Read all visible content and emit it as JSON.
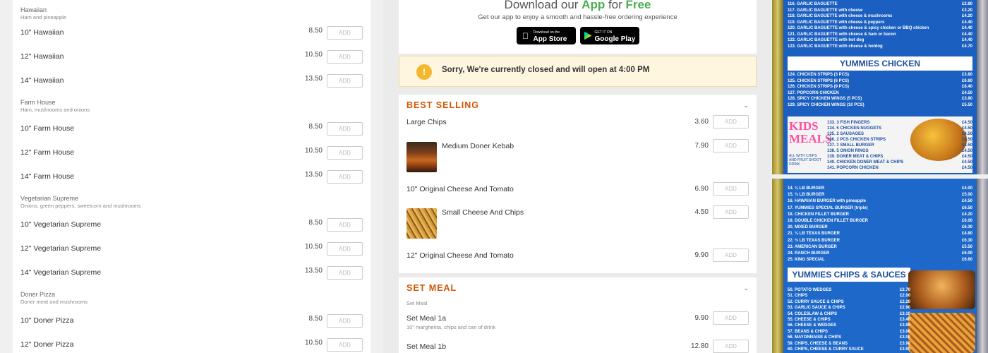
{
  "menu": {
    "add_label": "ADD",
    "groups": [
      {
        "title": "Hawaiian",
        "desc": "Ham and pineapple",
        "items": [
          {
            "name": "10\" Hawaiian",
            "price": "8.50"
          },
          {
            "name": "12\" Hawaiian",
            "price": "10.50"
          },
          {
            "name": "14\" Hawaiian",
            "price": "13.50"
          }
        ]
      },
      {
        "title": "Farm House",
        "desc": "Ham, mushrooms and onions",
        "items": [
          {
            "name": "10\" Farm House",
            "price": "8.50"
          },
          {
            "name": "12\" Farm House",
            "price": "10.50"
          },
          {
            "name": "14\" Farm House",
            "price": "13.50"
          }
        ]
      },
      {
        "title": "Vegetarian Supreme",
        "desc": "Onions, green peppers, sweetcorn and mushrooms",
        "items": [
          {
            "name": "10\" Vegetarian Supreme",
            "price": "8.50"
          },
          {
            "name": "12\" Vegetarian Supreme",
            "price": "10.50"
          },
          {
            "name": "14\" Vegetarian Supreme",
            "price": "13.50"
          }
        ]
      },
      {
        "title": "Doner Pizza",
        "desc": "Doner meat and mushrooms",
        "items": [
          {
            "name": "10\" Doner Pizza",
            "price": "8.50"
          },
          {
            "name": "12\" Doner Pizza",
            "price": "10.50"
          }
        ]
      }
    ]
  },
  "app_promo": {
    "title_prefix": "Download our ",
    "title_app": "App",
    "title_mid": " for ",
    "title_free": "Free",
    "subtitle": "Get our app to enjoy a smooth and hassle-free ordering experience",
    "appstore_small": "Download on the",
    "appstore_big": "App Store",
    "googleplay_small": "GET IT ON",
    "googleplay_big": "Google Play"
  },
  "notice": {
    "icon": "!",
    "text": "Sorry, We're currently closed and will open at 4:00 PM"
  },
  "best_selling": {
    "title": "BEST SELLING",
    "items": [
      {
        "name": "Large Chips",
        "price": "3.60"
      },
      {
        "name": "Medium Doner Kebab",
        "price": "7.90"
      },
      {
        "name": "10\" Original Cheese And Tomato",
        "price": "6.90"
      },
      {
        "name": "Small Cheese And Chips",
        "price": "4.50"
      },
      {
        "name": "12\" Original Cheese And Tomato",
        "price": "9.90"
      }
    ]
  },
  "set_meal": {
    "title": "SET MEAL",
    "label": "Set Meal",
    "items": [
      {
        "name": "Set Meal 1a",
        "desc": "10\" margherita, chips and can of drink",
        "price": "9.90"
      },
      {
        "name": "Set Meal 1b",
        "price": "12.80"
      }
    ]
  },
  "photo_top": {
    "lines": [
      {
        "t": "116. GARLIC BAGUETTE",
        "p": "£2.80"
      },
      {
        "t": "117. GARLIC BAGUETTE with cheese",
        "p": "£3.20"
      },
      {
        "t": "118. GARLIC BAGUETTE with cheese & mushrooms",
        "p": "£4.20"
      },
      {
        "t": "119. GARLIC BAGUETTE with cheese & peppers",
        "p": "£4.40"
      },
      {
        "t": "120. GARLIC BAGUETTE with cheese & spicy chicken or BBQ chicken",
        "p": "£4.40"
      },
      {
        "t": "121. GARLIC BAGUETTE with cheese & ham or bacon",
        "p": "£4.40"
      },
      {
        "t": "122. GARLIC BAGUETTE with hot dog",
        "p": "£4.40"
      },
      {
        "t": "123. GARLIC BAGUETTE with cheese & hotdog",
        "p": "£4.70"
      }
    ],
    "banner": "YUMMIES CHICKEN",
    "chicken": [
      {
        "t": "124. CHICKEN STRIPS (3 PCS)",
        "p": "£3.80"
      },
      {
        "t": "125. CHICKEN STRIPS (6 PCS)",
        "p": "£6.60"
      },
      {
        "t": "126. CHICKEN STRIPS (9 PCS)",
        "p": "£8.40"
      },
      {
        "t": "127. POPCORN CHICKEN",
        "p": "£4.50"
      },
      {
        "t": "128. SPICY CHICKEN WINGS (5 PCS)",
        "p": "£3.80"
      },
      {
        "t": "129. SPICY CHICKEN WINGS (10 PCS)",
        "p": "£5.50"
      }
    ],
    "kids_title": "KIDS MEALS",
    "kids_sub": "ALL WITH CHIPS AND FRUIT SHOOT DRINK",
    "kids": [
      {
        "t": "133. 3 FISH FINGERS",
        "p": "£4.50"
      },
      {
        "t": "134. 5 CHICKEN NUGGETS",
        "p": "£4.50"
      },
      {
        "t": "135. 2 SAUSAGES",
        "p": "£4.50"
      },
      {
        "t": "136. 2 PCS CHICKEN STRIPS",
        "p": "£4.50"
      },
      {
        "t": "137. 1 SMALL BURGER",
        "p": "£4.50"
      },
      {
        "t": "138. 5 ONION RINGS",
        "p": "£4.50"
      },
      {
        "t": "139. DONER MEAT & CHIPS",
        "p": "£4.50"
      },
      {
        "t": "140. CHICKEN DONER MEAT & CHIPS",
        "p": "£4.50"
      },
      {
        "t": "141. POPCORN CHICKEN",
        "p": "£4.50"
      }
    ]
  },
  "photo_bot": {
    "burgers": [
      {
        "t": "14. ¼ LB BURGER",
        "p": "£4.00"
      },
      {
        "t": "15. ½ LB BURGER",
        "p": "£5.00"
      },
      {
        "t": "16. HAWAIIAN BURGER with pineapple",
        "p": "£4.50"
      },
      {
        "t": "17. YUMMIES SPECIAL BURGER (triple)",
        "p": "£6.50"
      },
      {
        "t": "18. CHICKEN FILLET BURGER",
        "p": "£4.20"
      },
      {
        "t": "19. DOUBLE CHICKEN FILLET BURGER",
        "p": "£6.00"
      },
      {
        "t": "20. MIXED BURGER",
        "p": "£6.30"
      },
      {
        "t": "21. ¼ LB TEXAS BURGER",
        "p": "£4.80"
      },
      {
        "t": "22. ½ LB TEXAS BURGER",
        "p": "£6.30"
      },
      {
        "t": "23. AMERICAN BURGER",
        "p": "£5.50"
      },
      {
        "t": "24. RANCH BURGER",
        "p": "£6.00"
      },
      {
        "t": "25. KING SPECIAL",
        "p": "£6.60"
      }
    ],
    "banner": "YUMMIES CHIPS & SAUCES",
    "chips": [
      {
        "t": "50. POTATO WEDGES",
        "p": "£2.70"
      },
      {
        "t": "51. CHIPS",
        "p": "£2.00"
      },
      {
        "t": "52. CURRY SAUCE & CHIPS",
        "p": "£2.20"
      },
      {
        "t": "53. GARLIC SAUCE & CHIPS",
        "p": "£2.90"
      },
      {
        "t": "54. COLESLAW & CHIPS",
        "p": "£3.10"
      },
      {
        "t": "55. CHEESE & CHIPS",
        "p": "£3.40"
      },
      {
        "t": "56. CHEESE & WEDGES",
        "p": "£3.90"
      },
      {
        "t": "57. BEANS & CHIPS",
        "p": "£3.00"
      },
      {
        "t": "58. MAYONNAISE & CHIPS",
        "p": "£3.00"
      },
      {
        "t": "59. CHIPS, CHEESE & BEANS",
        "p": "£3.90"
      },
      {
        "t": "60. CHIPS, CHEESE & CURRY SAUCE",
        "p": "£3.90"
      }
    ]
  }
}
